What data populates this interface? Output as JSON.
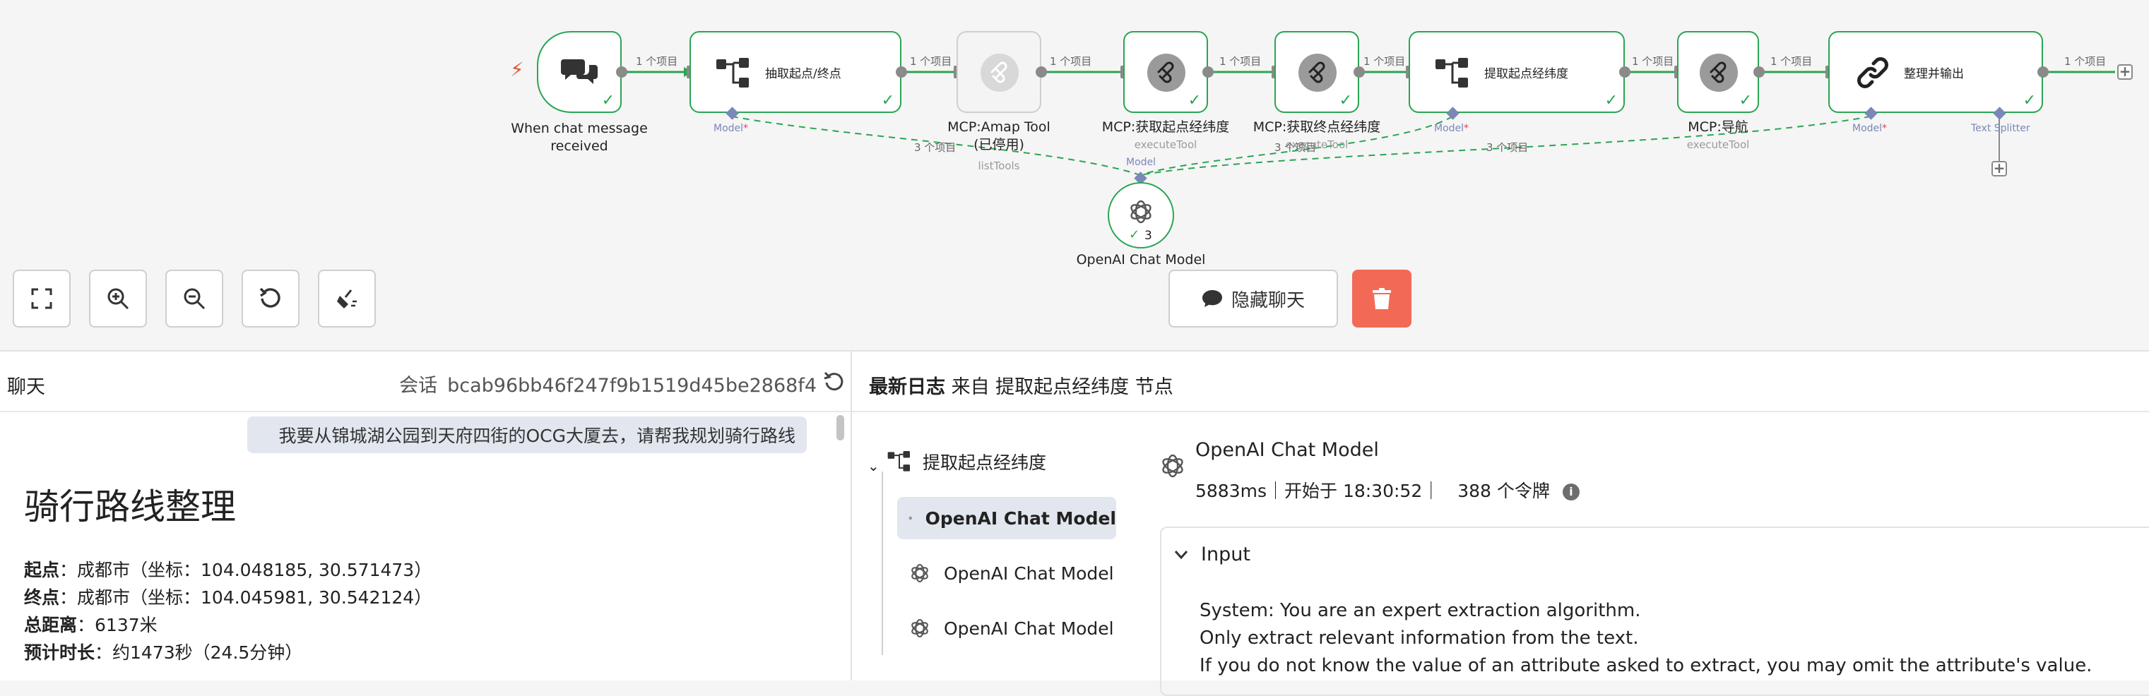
{
  "canvas": {
    "nodes": [
      {
        "id": "trigger",
        "label_line1": "When chat message",
        "label_line2": "received",
        "icon": "chat-bubbles-icon"
      },
      {
        "id": "extract1",
        "title": "抽取起点/终点",
        "port_label": "Model",
        "icon": "tree-branch-icon"
      },
      {
        "id": "amap",
        "label_line1": "MCP:Amap Tool",
        "label_line2": "(已停用)",
        "sub": "listTools",
        "icon": "mcp-icon"
      },
      {
        "id": "get_start",
        "label": "MCP:获取起点经纬度",
        "sub": "executeTool",
        "icon": "mcp-icon"
      },
      {
        "id": "get_end",
        "label": "MCP:获取终点经纬度",
        "sub": "executeTool",
        "icon": "mcp-icon"
      },
      {
        "id": "extract2",
        "title": "提取起点经纬度",
        "port_label": "Model",
        "icon": "tree-branch-icon"
      },
      {
        "id": "nav",
        "label": "MCP:导航",
        "sub": "executeTool",
        "icon": "mcp-icon"
      },
      {
        "id": "output",
        "title": "整理并输出",
        "port_label": "Model",
        "port_label2": "Text Splitter",
        "icon": "link-icon"
      },
      {
        "id": "openai",
        "label": "OpenAI Chat Model",
        "port_label": "Model",
        "count": "3",
        "icon": "openai-icon"
      }
    ],
    "edge_label": "1 个项目",
    "model_edge_label": "3 个项目",
    "required_mark": "*",
    "edge_color": "#2aa552",
    "model_edge_color": "#2aa552"
  },
  "toolbar": {
    "buttons": [
      "fit-view",
      "zoom-in",
      "zoom-out",
      "reset-zoom",
      "clear-execution"
    ],
    "hide_chat_label": "隐藏聊天"
  },
  "chat": {
    "title": "聊天",
    "session_label": "会话",
    "session_id": "bcab96bb46f247f9b1519d45be2868f4",
    "user_message": "我要从锦城湖公园到天府四街的OCG大厦去，请帮我规划骑行路线",
    "response_title": "骑行路线整理",
    "lines": [
      {
        "label": "起点",
        "value": "：成都市（坐标：104.048185, 30.571473）"
      },
      {
        "label": "终点",
        "value": "：成都市（坐标：104.045981, 30.542124）"
      },
      {
        "label": "总距离",
        "value": "：6137米"
      },
      {
        "label": "预计时长",
        "value": "：约1473秒（24.5分钟）"
      }
    ]
  },
  "log": {
    "title_bold": "最新日志",
    "title_rest": "来自 提取起点经纬度 节点",
    "tree_root": "提取起点经纬度",
    "tree_items": [
      "OpenAI Chat Model",
      "OpenAI Chat Model",
      "OpenAI Chat Model"
    ],
    "node_title": "OpenAI Chat Model",
    "meta": "5883ms｜开始于 18:30:52｜　388 个令牌",
    "input_label": "Input",
    "input_lines": [
      "System: You are an expert extraction algorithm.",
      "Only extract relevant information from the text.",
      "If you do not know the value of an attribute asked to extract, you may omit the attribute's value."
    ]
  },
  "colors": {
    "success": "#2aa552",
    "danger": "#f26a56",
    "port": "#7a87b8",
    "bolt": "#e0583a"
  }
}
